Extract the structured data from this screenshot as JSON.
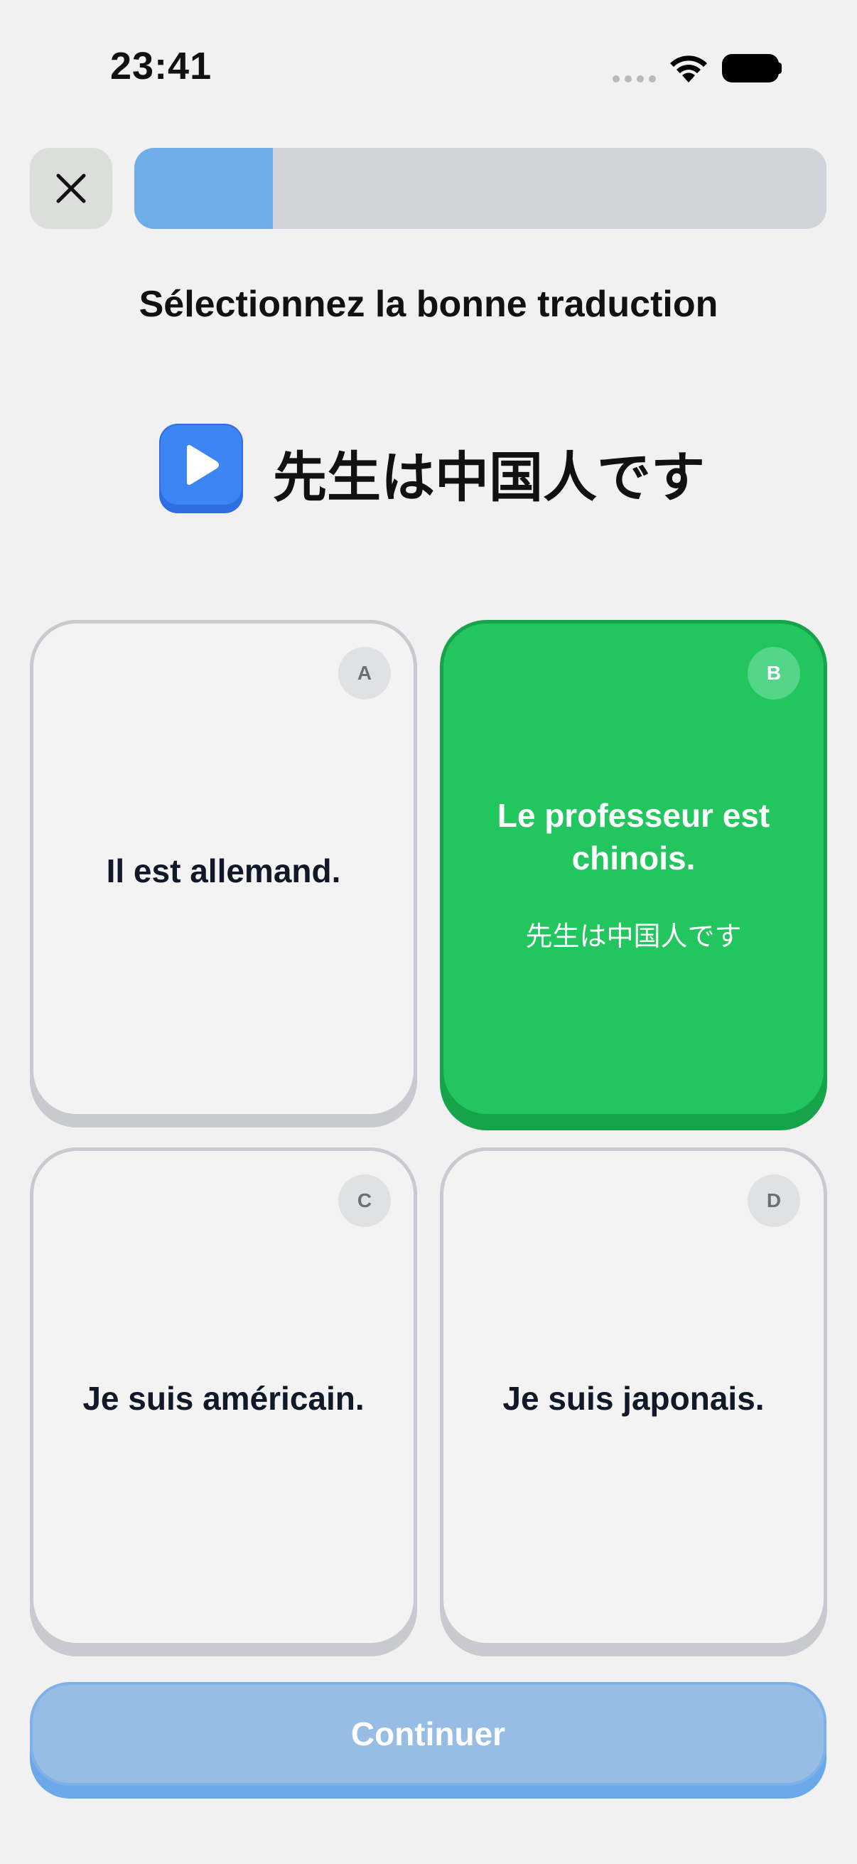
{
  "status_bar": {
    "time": "23:41"
  },
  "progress": {
    "value": 0.2
  },
  "instruction": "Sélectionnez la bonne traduction",
  "prompt": {
    "text": "先生は中国人です"
  },
  "options": [
    {
      "letter": "A",
      "text": "Il est allemand.",
      "state": "neutral"
    },
    {
      "letter": "B",
      "text": "Le professeur est chinois.",
      "subtext": "先生は中国人です",
      "state": "correct"
    },
    {
      "letter": "C",
      "text": "Je suis américain.",
      "state": "neutral"
    },
    {
      "letter": "D",
      "text": "Je suis japonais.",
      "state": "neutral"
    }
  ],
  "continue_label": "Continuer",
  "icons": {
    "close": "close-icon",
    "play": "play-icon",
    "wifi": "wifi-icon",
    "battery": "battery-icon"
  },
  "colors": {
    "correct": "#22c55e",
    "accent": "#3d85f4",
    "continue": "#97bde4"
  }
}
